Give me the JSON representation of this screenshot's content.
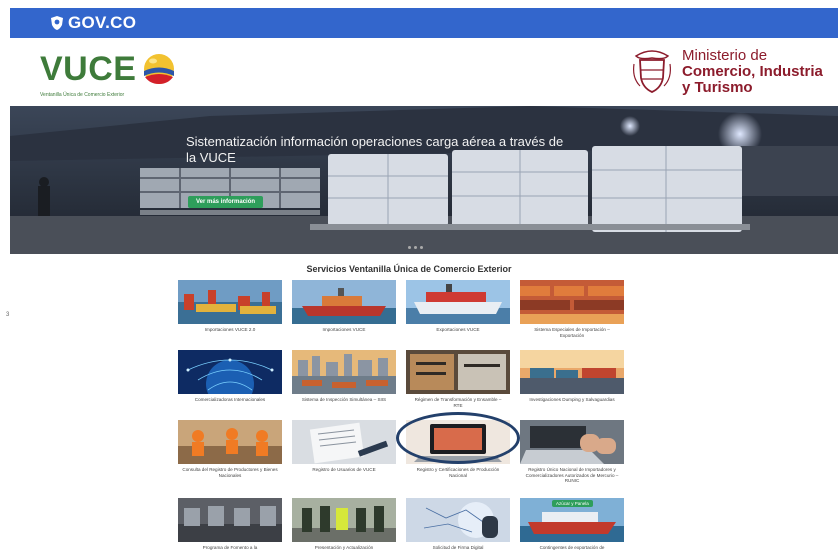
{
  "govbar": {
    "brand": "GOV.CO"
  },
  "header": {
    "vuce_logo": "VUCE",
    "vuce_tagline": "Ventanilla Única de Comercio Exterior",
    "ministry_line1": "Ministerio de",
    "ministry_line2": "Comercio, Industria",
    "ministry_line3": "y Turismo"
  },
  "hero": {
    "title": "Sistematización información operaciones carga aérea a través de la VUCE",
    "button_label": "Ver más información"
  },
  "side_marker": "3",
  "services": {
    "title": "Servicios Ventanilla Única de Comercio Exterior",
    "tiles": [
      {
        "label": "Importaciones VUCE 2.0",
        "theme": "port"
      },
      {
        "label": "Importaciones VUCE",
        "theme": "ship-red"
      },
      {
        "label": "Exportaciones VUCE",
        "theme": "ship-white"
      },
      {
        "label": "Sistema Especiales de Importación – Exportación",
        "theme": "containers"
      },
      {
        "label": "Comercializadoras Internacionales",
        "theme": "network"
      },
      {
        "label": "Sistema de Inspección Simultánea – SIIS",
        "theme": "city"
      },
      {
        "label": "Régimen de Transformación y Ensamble – RTE",
        "theme": "factory"
      },
      {
        "label": "Investigaciones Dumping y Salvaguardias",
        "theme": "sunset"
      },
      {
        "label": "Consulta del Registro de Productores y Bienes Nacionales",
        "theme": "workers"
      },
      {
        "label": "Registro de Usuarios de VUCE",
        "theme": "docs"
      },
      {
        "label": "Registro y Certificaciones de Producción Nacional",
        "theme": "laptop"
      },
      {
        "label": "Registro Único Nacional de Importadores y Comercializadores Autorizados de Mercurio – RUNIC",
        "theme": "typing"
      },
      {
        "label": "Programa de Fomento a la",
        "theme": "assembly"
      },
      {
        "label": "Presentación y Actualización",
        "theme": "police"
      },
      {
        "label": "Solicitud de Firma Digital",
        "theme": "digital"
      },
      {
        "label": "Contingentes de exportación de",
        "theme": "ship-green",
        "badge": "Azúcar y Panela"
      }
    ]
  }
}
